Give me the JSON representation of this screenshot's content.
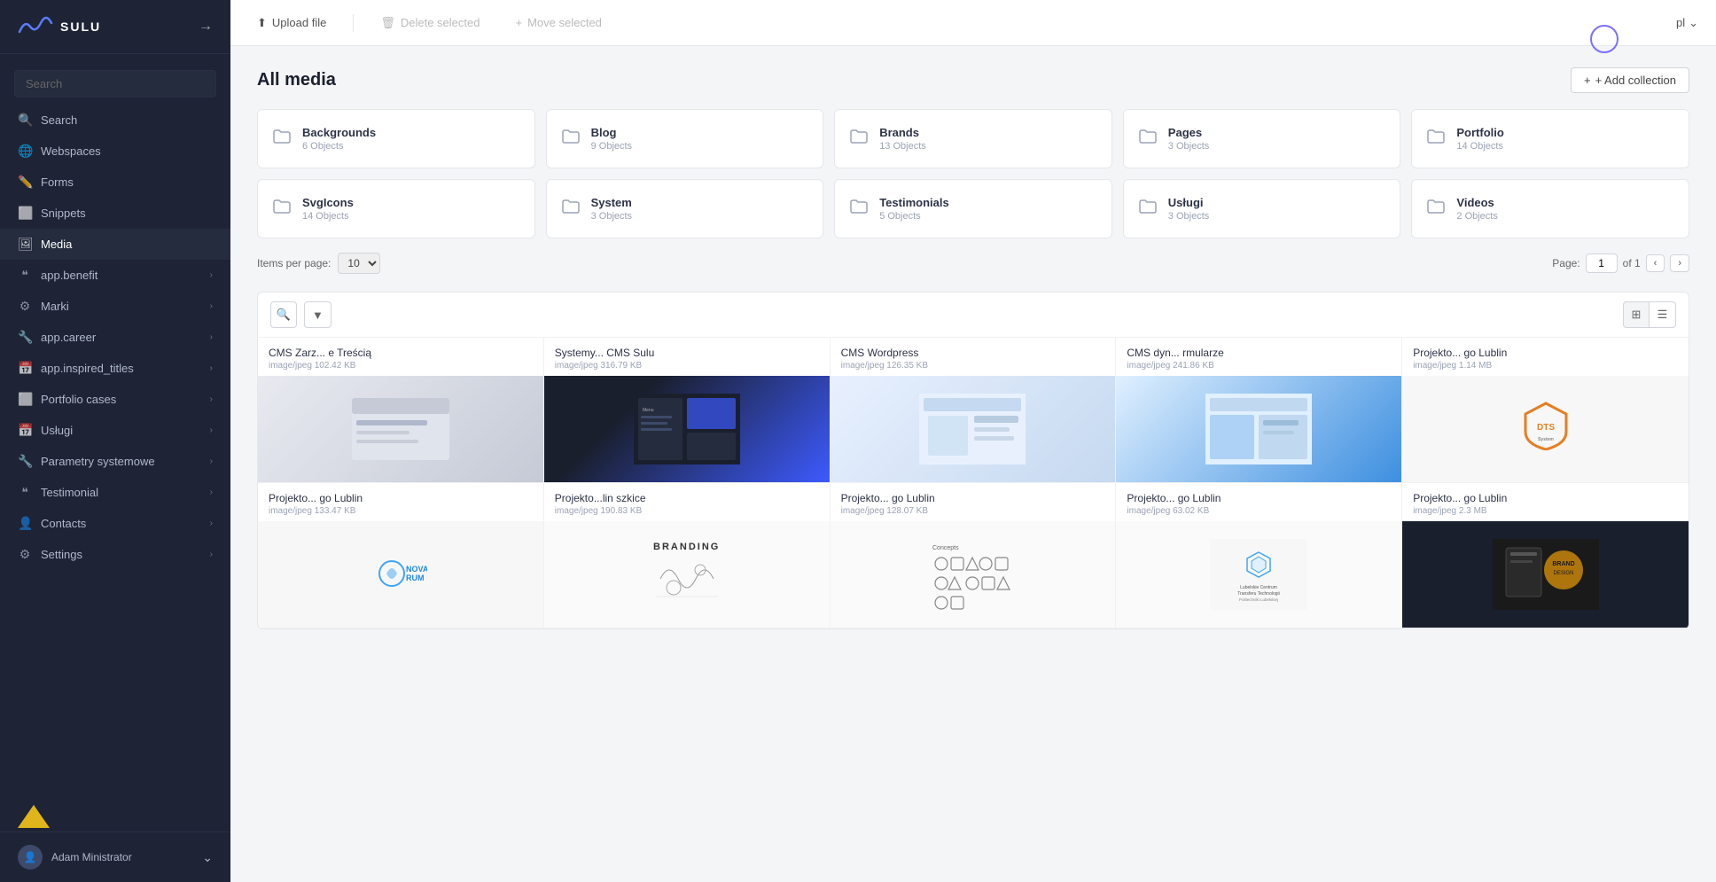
{
  "app": {
    "name": "SULU"
  },
  "toolbar": {
    "upload_label": "Upload file",
    "delete_label": "Delete selected",
    "move_label": "Move selected",
    "lang": "pl",
    "add_collection_label": "+ Add collection"
  },
  "page_title": "All media",
  "sidebar": {
    "search_placeholder": "Search",
    "items": [
      {
        "id": "search",
        "label": "Search",
        "icon": "🔍",
        "has_chevron": false
      },
      {
        "id": "webspaces",
        "label": "Webspaces",
        "icon": "🌐",
        "has_chevron": false
      },
      {
        "id": "forms",
        "label": "Forms",
        "icon": "✏️",
        "has_chevron": false
      },
      {
        "id": "snippets",
        "label": "Snippets",
        "icon": "⬜",
        "has_chevron": false
      },
      {
        "id": "media",
        "label": "Media",
        "icon": "🖼",
        "has_chevron": false,
        "active": true
      },
      {
        "id": "app_benefit",
        "label": "app.benefit",
        "icon": "❝",
        "has_chevron": true
      },
      {
        "id": "marki",
        "label": "Marki",
        "icon": "⚙",
        "has_chevron": true
      },
      {
        "id": "app_career",
        "label": "app.career",
        "icon": "✏️",
        "has_chevron": true
      },
      {
        "id": "app_inspired",
        "label": "app.inspired_titles",
        "icon": "📅",
        "has_chevron": true
      },
      {
        "id": "portfolio",
        "label": "Portfolio cases",
        "icon": "⬜",
        "has_chevron": true
      },
      {
        "id": "uslugi",
        "label": "Usługi",
        "icon": "📅",
        "has_chevron": true
      },
      {
        "id": "parametry",
        "label": "Parametry systemowe",
        "icon": "✏️",
        "has_chevron": true
      },
      {
        "id": "testimonial",
        "label": "Testimonial",
        "icon": "❝",
        "has_chevron": true
      },
      {
        "id": "contacts",
        "label": "Contacts",
        "icon": "👤",
        "has_chevron": true
      },
      {
        "id": "settings",
        "label": "Settings",
        "icon": "⚙",
        "has_chevron": true
      }
    ],
    "footer_user": "Adam Ministrator"
  },
  "folders": [
    {
      "name": "Backgrounds",
      "count": "6 Objects"
    },
    {
      "name": "Blog",
      "count": "9 Objects"
    },
    {
      "name": "Brands",
      "count": "13 Objects"
    },
    {
      "name": "Pages",
      "count": "3 Objects"
    },
    {
      "name": "Portfolio",
      "count": "14 Objects"
    },
    {
      "name": "SvgIcons",
      "count": "14 Objects"
    },
    {
      "name": "System",
      "count": "3 Objects"
    },
    {
      "name": "Testimonials",
      "count": "5 Objects"
    },
    {
      "name": "Usługi",
      "count": "3 Objects"
    },
    {
      "name": "Videos",
      "count": "2 Objects"
    }
  ],
  "pagination": {
    "items_per_page_label": "Items per page:",
    "items_per_page": "10",
    "page_label": "Page:",
    "current_page": "1",
    "total_pages": "of 1"
  },
  "media_items": [
    {
      "name": "CMS Zarz... e Treścią",
      "meta": "image/jpeg 102.42 KB",
      "thumb_class": "thumb-cms1"
    },
    {
      "name": "Systemy... CMS Sulu",
      "meta": "image/jpeg 316.79 KB",
      "thumb_class": "thumb-cms2"
    },
    {
      "name": "CMS Wordpress",
      "meta": "image/jpeg 126.35 KB",
      "thumb_class": "thumb-cms3"
    },
    {
      "name": "CMS dyn... rmularze",
      "meta": "image/jpeg 241.86 KB",
      "thumb_class": "thumb-cms4"
    },
    {
      "name": "Projekto... go Lublin",
      "meta": "image/jpeg 1.14 MB",
      "thumb_class": "thumb-dts"
    },
    {
      "name": "Projekto... go Lublin",
      "meta": "image/jpeg 133.47 KB",
      "thumb_class": "thumb-novarum"
    },
    {
      "name": "Projekto...lin szkice",
      "meta": "image/jpeg 190.83 KB",
      "thumb_class": "thumb-branding"
    },
    {
      "name": "Projekto... go Lublin",
      "meta": "image/jpeg 128.07 KB",
      "thumb_class": "thumb-concepts"
    },
    {
      "name": "Projekto... go Lublin",
      "meta": "image/jpeg 63.02 KB",
      "thumb_class": "thumb-lctt"
    },
    {
      "name": "Projekto... go Lublin",
      "meta": "image/jpeg 2.3 MB",
      "thumb_class": "thumb-proj5"
    }
  ]
}
